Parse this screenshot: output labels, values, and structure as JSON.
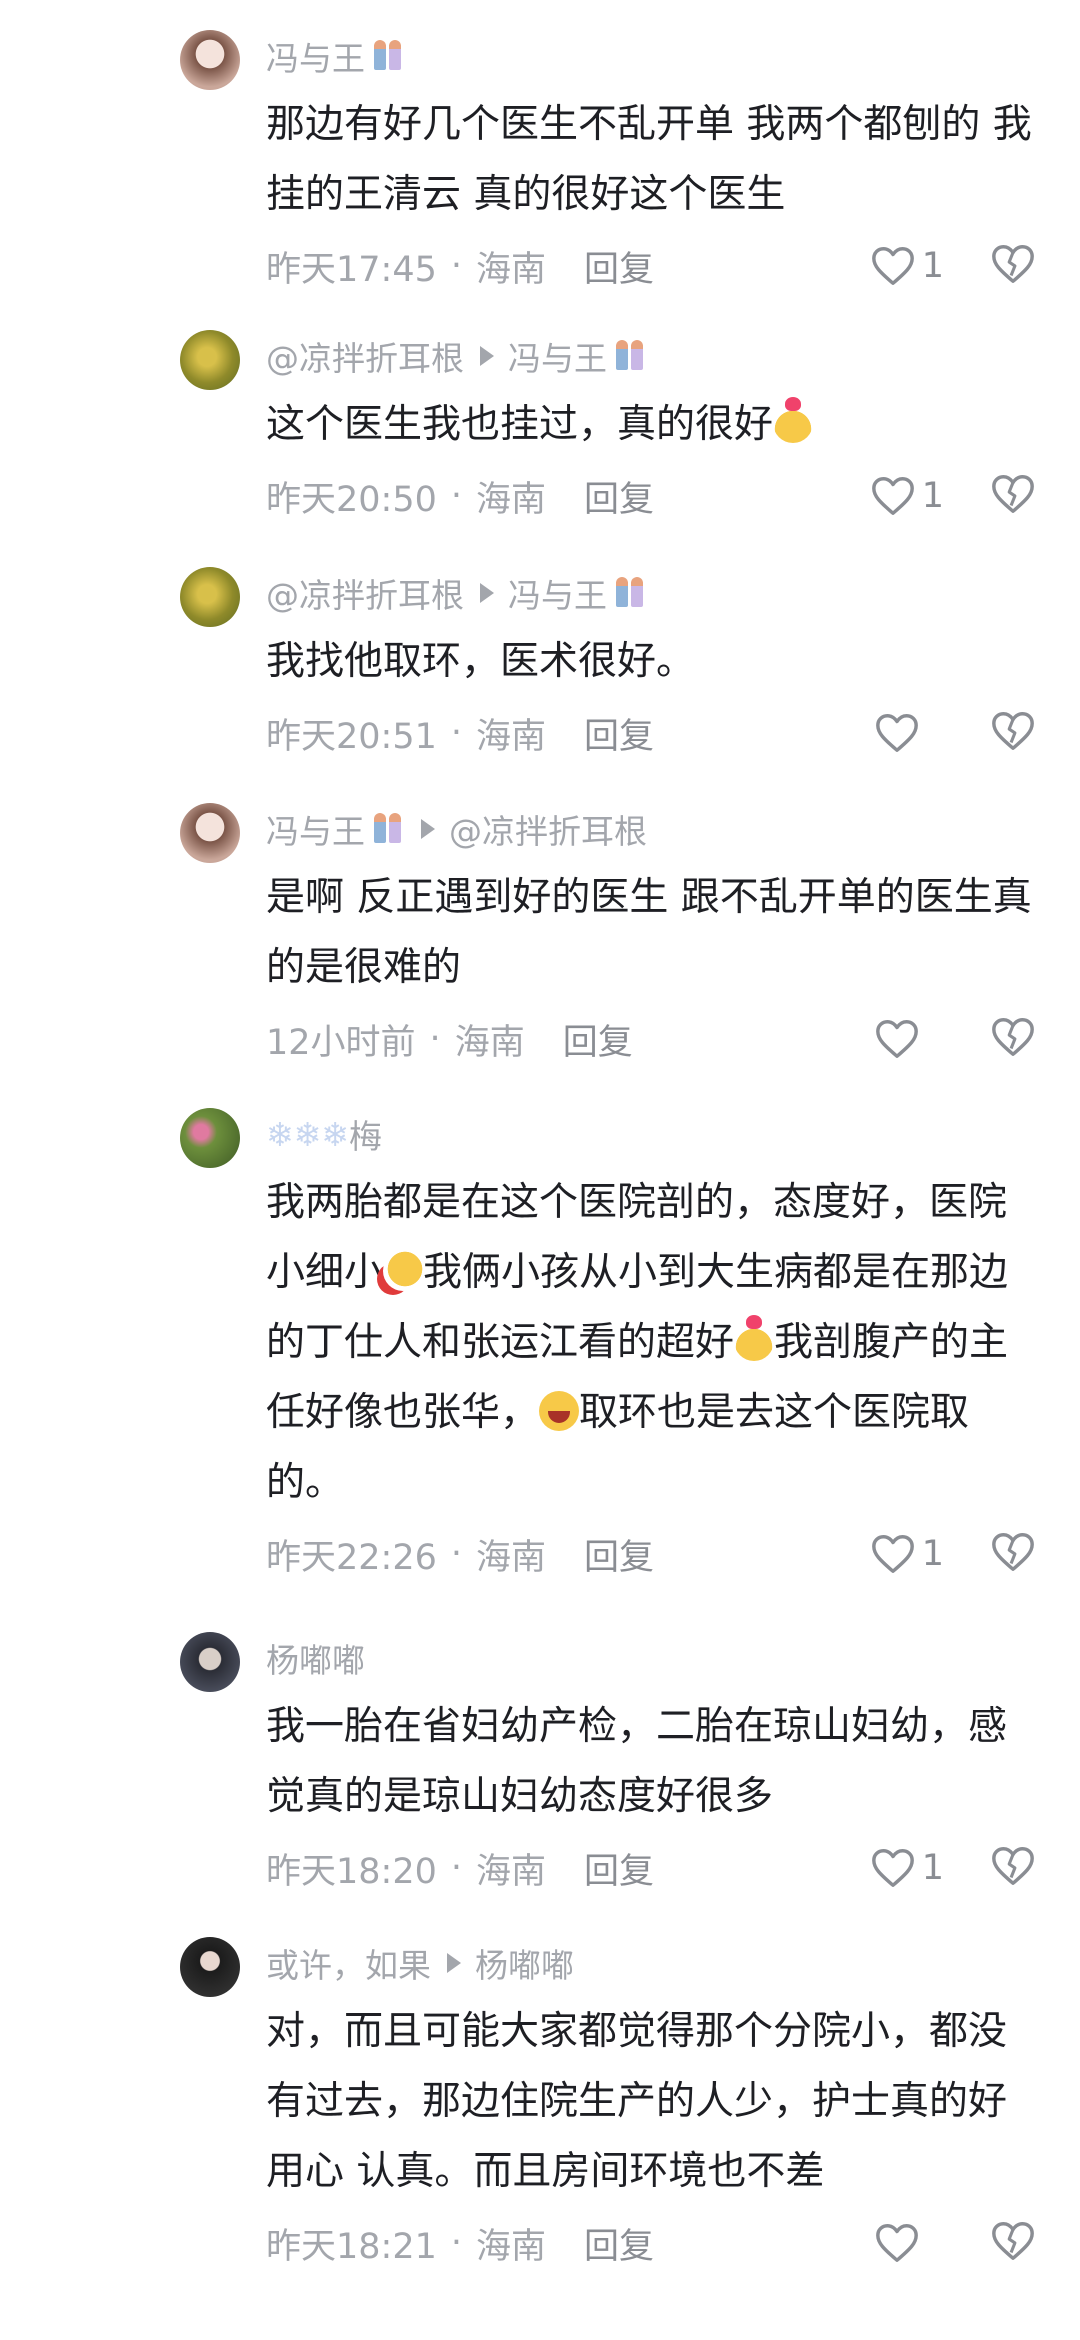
{
  "comments": [
    {
      "avatar_color": "#e9d6d0",
      "name": "冯与王",
      "name_badge": true,
      "reply_to": "",
      "text": "那边有好几个医生不乱开单  我两个都刨的 我挂的王清云  真的很好这个医生",
      "time": "昨天17:45",
      "location": "海南",
      "reply_label": "回复",
      "likes": "1"
    },
    {
      "avatar_color": "#9a9a2a",
      "name": "@凉拌折耳根",
      "reply_to": "冯与王",
      "reply_badge": true,
      "text": "这个医生我也挂过，真的很好",
      "emoji_after": "heart-hand",
      "time": "昨天20:50",
      "location": "海南",
      "reply_label": "回复",
      "likes": "1"
    },
    {
      "avatar_color": "#9a9a2a",
      "name": "@凉拌折耳根",
      "reply_to": "冯与王",
      "reply_badge": true,
      "text": "我找他取环，医术很好。",
      "time": "昨天20:51",
      "location": "海南",
      "reply_label": "回复",
      "likes": ""
    },
    {
      "avatar_color": "#e9d6d0",
      "name": "冯与王",
      "name_badge": true,
      "reply_to": "@凉拌折耳根",
      "text": "是啊 反正遇到好的医生 跟不乱开单的医生真的是很难的",
      "time": "12小时前",
      "location": "海南",
      "reply_label": "回复",
      "likes": ""
    },
    {
      "avatar_color": "#5c7a3a",
      "name": "梅",
      "name_prefix": "❄❄❄",
      "reply_to": "",
      "text_parts": [
        "我两胎都是在这个医院剖的，态度好，医院小细小",
        "我俩小孩从小到大生病都是在那边的丁仕人和张运江看的超好",
        "我剖腹产的主任好像也张华，",
        "取环也是去这个医院取的。"
      ],
      "time": "昨天22:26",
      "location": "海南",
      "reply_label": "回复",
      "likes": "1"
    },
    {
      "avatar_color": "#2b2d36",
      "name": "杨嘟嘟",
      "reply_to": "",
      "text": "我一胎在省妇幼产检，二胎在琼山妇幼，感觉真的是琼山妇幼态度好很多",
      "time": "昨天18:20",
      "location": "海南",
      "reply_label": "回复",
      "likes": "1"
    },
    {
      "avatar_color": "#1c1c1c",
      "name": "或许，如果",
      "reply_to": "杨嘟嘟",
      "text": "对，而且可能大家都觉得那个分院小，都没有过去，那边住院生产的人少，护士真的好用心 认真。而且房间环境也不差",
      "time": "昨天18:21",
      "location": "海南",
      "reply_label": "回复",
      "likes": ""
    }
  ]
}
